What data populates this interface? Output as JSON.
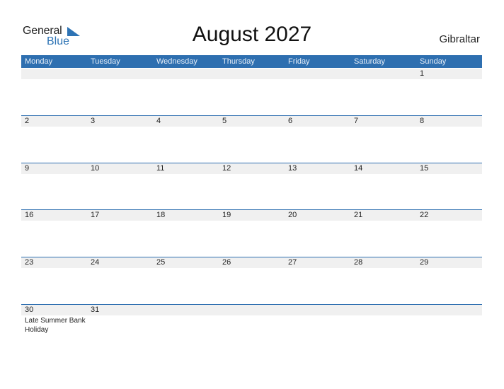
{
  "logo": {
    "general": "General",
    "blue": "Blue"
  },
  "title": "August 2027",
  "country": "Gibraltar",
  "weekdays": [
    "Monday",
    "Tuesday",
    "Wednesday",
    "Thursday",
    "Friday",
    "Saturday",
    "Sunday"
  ],
  "weeks": [
    [
      "",
      "",
      "",
      "",
      "",
      "",
      "1"
    ],
    [
      "2",
      "3",
      "4",
      "5",
      "6",
      "7",
      "8"
    ],
    [
      "9",
      "10",
      "11",
      "12",
      "13",
      "14",
      "15"
    ],
    [
      "16",
      "17",
      "18",
      "19",
      "20",
      "21",
      "22"
    ],
    [
      "23",
      "24",
      "25",
      "26",
      "27",
      "28",
      "29"
    ],
    [
      "30",
      "31",
      "",
      "",
      "",
      "",
      ""
    ]
  ],
  "events": {
    "30": "Late Summer Bank Holiday"
  },
  "colors": {
    "accent": "#2e6fb0",
    "strip": "#f0f0f0"
  }
}
